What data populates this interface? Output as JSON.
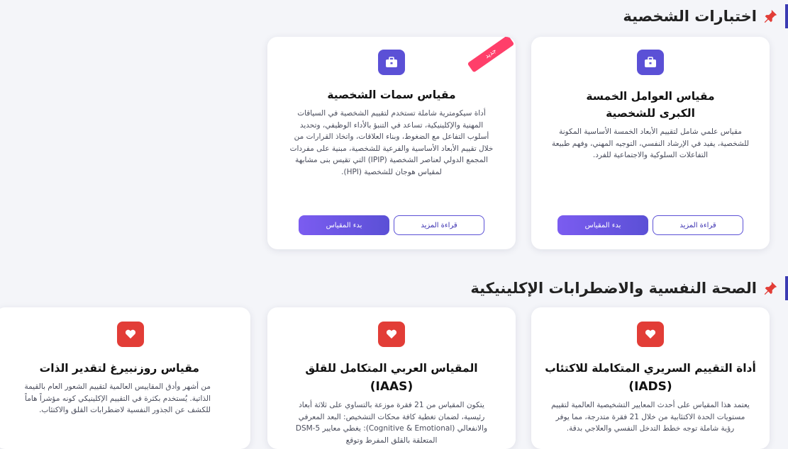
{
  "colors": {
    "accent": "#5b50d6",
    "danger": "#e23d37",
    "ribbon": "#ff3f6a"
  },
  "section1": {
    "title": "اختبارات الشخصية",
    "icon": "pin-icon",
    "cards": [
      {
        "icon": "briefcase-icon",
        "title": "مقياس العوامل الخمسة الكبرى للشخصية",
        "desc": "مقياس علمي شامل لتقييم الأبعاد الخمسة الأساسية المكونة للشخصية، يفيد في الإرشاد النفسي، التوجيه المهني، وفهم طبيعة التفاعلات السلوكية والاجتماعية للفرد.",
        "read_more": "قراءة المزيد",
        "start": "بدء المقياس"
      },
      {
        "icon": "briefcase-icon",
        "badge": "جديد",
        "title": "مقياس سمات الشخصية",
        "desc": "أداة سيكومترية شاملة تستخدم لتقييم الشخصية في السياقات المهنية والإكلينيكية، تساعد في التنبؤ بالأداء الوظيفي، وتحديد أسلوب التفاعل مع الضغوط، وبناء العلاقات، واتخاذ القرارات من خلال تقييم الأبعاد الأساسية والفرعية للشخصية، مبنية على مفردات المجمع الدولي لعناصر الشخصية (IPIP) التي تقيس بنى مشابهة لمقياس هوجان للشخصية (HPI).",
        "read_more": "قراءة المزيد",
        "start": "بدء المقياس"
      }
    ]
  },
  "section2": {
    "title": "الصحة النفسية والاضطرابات الإكلينيكية",
    "icon": "pin-icon",
    "cards": [
      {
        "icon": "heart-icon",
        "title": "أداة التقييم السريري المتكاملة للاكتئاب",
        "subtitle": "(IADS)",
        "desc": "يعتمد هذا المقياس على أحدث المعايير التشخيصية العالمية لتقييم مستويات الحدة الاكتئابية من خلال 21 فقرة متدرجة، مما يوفر رؤية شاملة توجه خطط التدخل النفسي والعلاجي بدقة."
      },
      {
        "icon": "heart-icon",
        "title": "المقياس العربي المتكامل للقلق",
        "subtitle": "(IAAS)",
        "desc": "يتكون المقياس من 21 فقرة موزعة بالتساوي على ثلاثة أبعاد رئيسية، لضمان تغطية كافة محكات التشخيص: البعد المعرفي والانفعالي (Cognitive & Emotional): يغطي معايير DSM-5 المتعلقة بالقلق المفرط وتوقع"
      },
      {
        "icon": "heart-icon",
        "title": "مقياس روزنبيرغ لتقدير الذات",
        "desc": "من أشهر وأدق المقاييس العالمية لتقييم الشعور العام بالقيمة الذاتية. يُستخدم بكثرة في التقييم الإكلينيكي كونه مؤشراً هاماً للكشف عن الجذور النفسية لاضطرابات القلق والاكتئاب."
      }
    ]
  }
}
